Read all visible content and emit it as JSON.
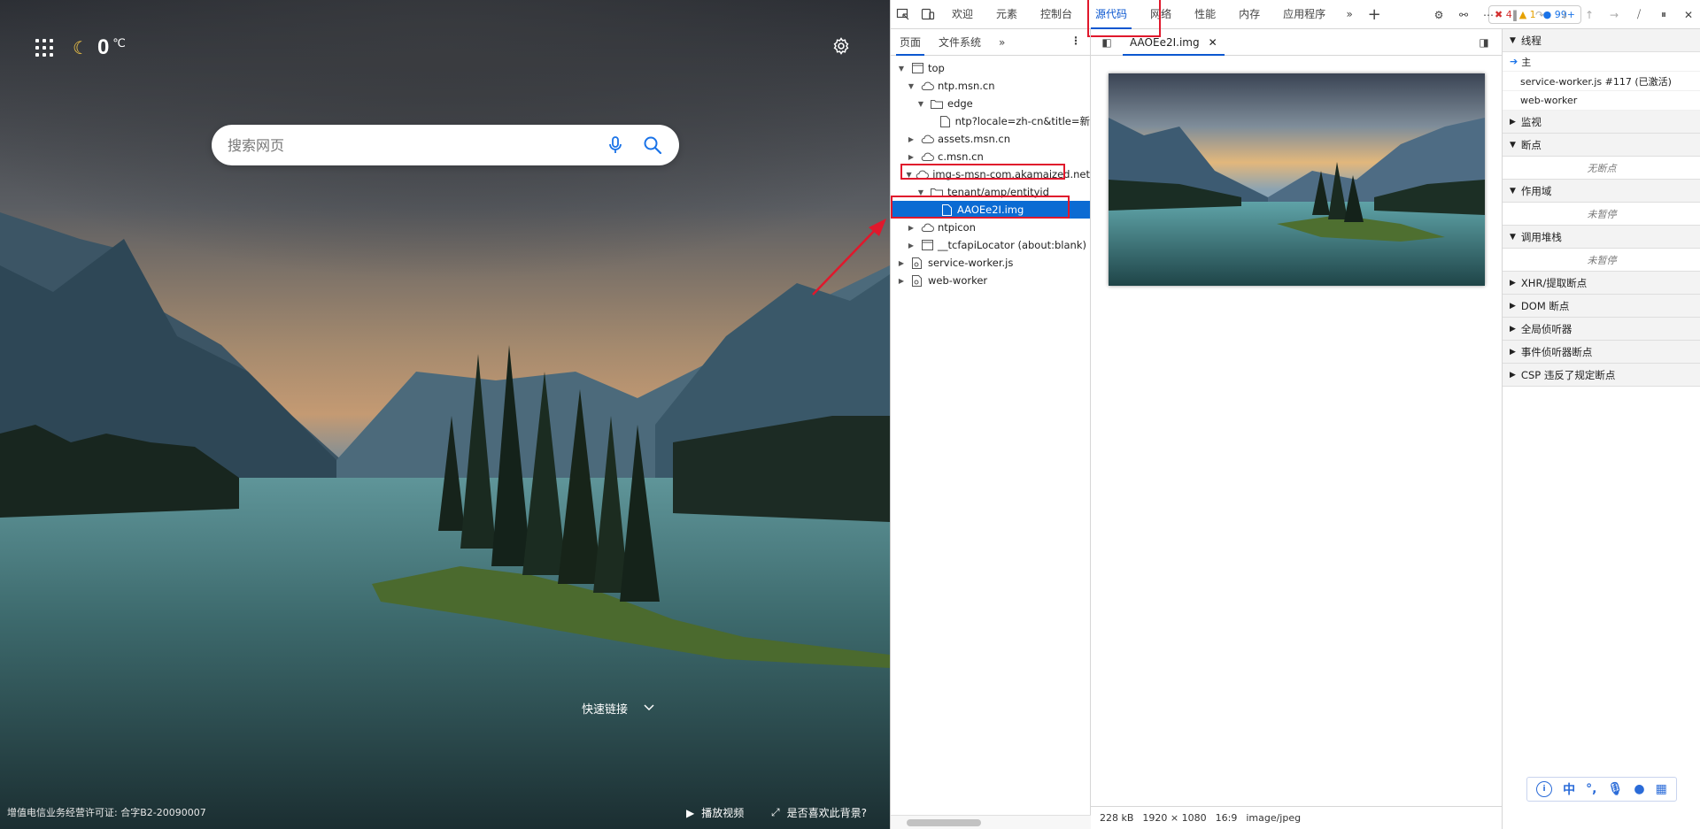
{
  "ntp": {
    "temperature": "0",
    "temp_unit": "℃",
    "search_placeholder": "搜索网页",
    "quick_links": "快速链接",
    "license": "增值电信业务经营许可证: 合字B2-20090007",
    "play_video": "播放视频",
    "like_background": "是否喜欢此背景?"
  },
  "devtools": {
    "tabs": [
      "欢迎",
      "元素",
      "控制台",
      "源代码",
      "网络",
      "性能",
      "内存",
      "应用程序"
    ],
    "active_tab": "源代码",
    "errors": "4",
    "warnings": "1",
    "messages": "99+",
    "navigator": {
      "subtabs": [
        "页面",
        "文件系统"
      ],
      "tree": [
        {
          "label": "top",
          "depth": 0,
          "expanded": true,
          "icon": "frame-icon"
        },
        {
          "label": "ntp.msn.cn",
          "depth": 1,
          "expanded": true,
          "icon": "cloud-icon"
        },
        {
          "label": "edge",
          "depth": 2,
          "expanded": true,
          "icon": "folder-icon"
        },
        {
          "label": "ntp?locale=zh-cn&title=新",
          "depth": 3,
          "expanded": null,
          "icon": "file-icon"
        },
        {
          "label": "assets.msn.cn",
          "depth": 1,
          "expanded": false,
          "icon": "cloud-icon"
        },
        {
          "label": "c.msn.cn",
          "depth": 1,
          "expanded": false,
          "icon": "cloud-icon"
        },
        {
          "label": "img-s-msn-com.akamaized.net",
          "depth": 1,
          "expanded": true,
          "icon": "cloud-icon"
        },
        {
          "label": "tenant/amp/entityid",
          "depth": 2,
          "expanded": true,
          "icon": "folder-icon"
        },
        {
          "label": "AAOEe2I.img",
          "depth": 3,
          "expanded": null,
          "icon": "file-icon",
          "selected": true
        },
        {
          "label": "ntpicon",
          "depth": 1,
          "expanded": false,
          "icon": "cloud-icon"
        },
        {
          "label": "__tcfapiLocator (about:blank)",
          "depth": 1,
          "expanded": false,
          "icon": "frame-icon"
        },
        {
          "label": "service-worker.js",
          "depth": 0,
          "expanded": false,
          "icon": "gear-file-icon"
        },
        {
          "label": "web-worker",
          "depth": 0,
          "expanded": false,
          "icon": "gear-file-icon"
        }
      ]
    },
    "editor": {
      "file_tab": "AAOEe2I.img",
      "status": {
        "size": "228 kB",
        "dimensions": "1920 × 1080",
        "ratio": "16:9",
        "mime": "image/jpeg"
      }
    },
    "debugger": {
      "threads_title": "线程",
      "threads": [
        "主",
        "service-worker.js #117 (已激活)",
        "web-worker"
      ],
      "sections": [
        {
          "title": "监视",
          "expanded": false
        },
        {
          "title": "断点",
          "expanded": true,
          "empty": "无断点"
        },
        {
          "title": "作用域",
          "expanded": true,
          "empty": "未暂停"
        },
        {
          "title": "调用堆栈",
          "expanded": true,
          "empty": "未暂停"
        },
        {
          "title": "XHR/提取断点",
          "expanded": false
        },
        {
          "title": "DOM 断点",
          "expanded": false
        },
        {
          "title": "全局侦听器",
          "expanded": false
        },
        {
          "title": "事件侦听器断点",
          "expanded": false
        },
        {
          "title": "CSP 违反了规定断点",
          "expanded": false
        }
      ]
    },
    "ime": {
      "lang": "中"
    }
  },
  "colors": {
    "accent": "#0b57d0",
    "selection": "#0b6bd3",
    "highlight_box": "#e0182c"
  }
}
